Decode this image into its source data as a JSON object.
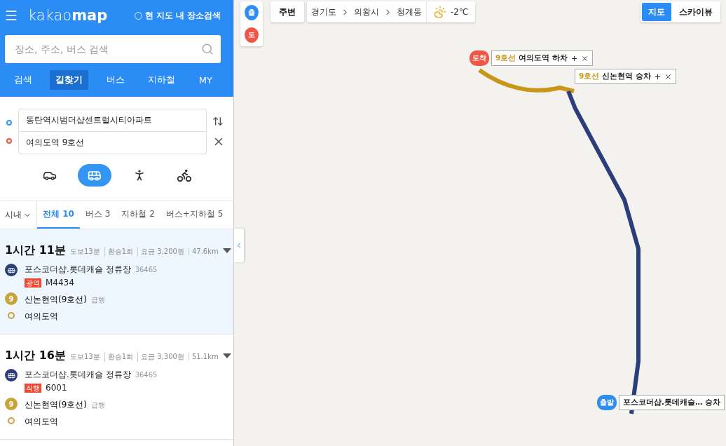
{
  "header": {
    "logo": "kakao**map**",
    "area_search": {
      "label": "현 지도 내 장소검색",
      "checked": false
    },
    "search": {
      "placeholder": "장소, 주소, 버스 검색"
    },
    "tabs": [
      {
        "label": "검색",
        "selected": false
      },
      {
        "label": "길찾기",
        "selected": true
      },
      {
        "label": "버스",
        "selected": false
      },
      {
        "label": "지하철",
        "selected": false
      },
      {
        "label": "MY",
        "selected": false
      }
    ]
  },
  "route_form": {
    "origin": "동탄역시범더샵센트럴시티아파트",
    "destination": "여의도역 9호선",
    "modes": [
      {
        "kind": "car",
        "selected": false
      },
      {
        "kind": "bus",
        "selected": true
      },
      {
        "kind": "walk",
        "selected": false
      },
      {
        "kind": "bike",
        "selected": false
      }
    ]
  },
  "filter": {
    "region": "시내",
    "tabs": [
      {
        "label": "전체 10",
        "selected": true
      },
      {
        "label": "버스 3",
        "selected": false
      },
      {
        "label": "지하철 2",
        "selected": false
      },
      {
        "label": "버스+지하철 5",
        "selected": false
      }
    ]
  },
  "results": [
    {
      "duration": "1시간 11분",
      "selected": true,
      "meta": [
        "도보13분",
        "환승1회",
        "요금 3,200원",
        "47.6km"
      ],
      "steps": [
        {
          "kind": "bus",
          "name": "포스코더샵.롯데캐슬 정류장",
          "stop_id": "36465",
          "badge": "광역",
          "route": "M4434"
        },
        {
          "kind": "subway",
          "line": "9",
          "name": "신논현역(9호선)",
          "note": "급행"
        },
        {
          "kind": "end",
          "name": "여의도역"
        }
      ]
    },
    {
      "duration": "1시간 16분",
      "selected": false,
      "meta": [
        "도보13분",
        "환승1회",
        "요금 3,300원",
        "51.1km"
      ],
      "steps": [
        {
          "kind": "bus",
          "name": "포스코더샵.롯데캐슬 정류장",
          "stop_id": "36465",
          "badge": "직행",
          "route": "6001"
        },
        {
          "kind": "subway",
          "line": "9",
          "name": "신논현역(9호선)",
          "note": "급행"
        },
        {
          "kind": "end",
          "name": "여의도역"
        }
      ]
    }
  ],
  "map": {
    "pins": [
      {
        "label": "출",
        "color": "#2f8cf0"
      },
      {
        "label": "도",
        "color": "#f05545"
      }
    ],
    "nearby": "주변",
    "breadcrumb": [
      "경기도",
      "의왕시",
      "청계동"
    ],
    "weather": "-2℃",
    "map_types": [
      {
        "label": "지도",
        "selected": true
      },
      {
        "label": "스카이뷰",
        "selected": false
      }
    ],
    "callouts": [
      {
        "kind": "arrive",
        "pin": "도착",
        "line": "9호선",
        "text": "여의도역 하차"
      },
      {
        "kind": "transfer",
        "line": "9호선",
        "text": "신논현역 승차"
      },
      {
        "kind": "depart",
        "pin": "출발",
        "text": "포스코더샵.롯데캐슬… 승차"
      }
    ]
  }
}
